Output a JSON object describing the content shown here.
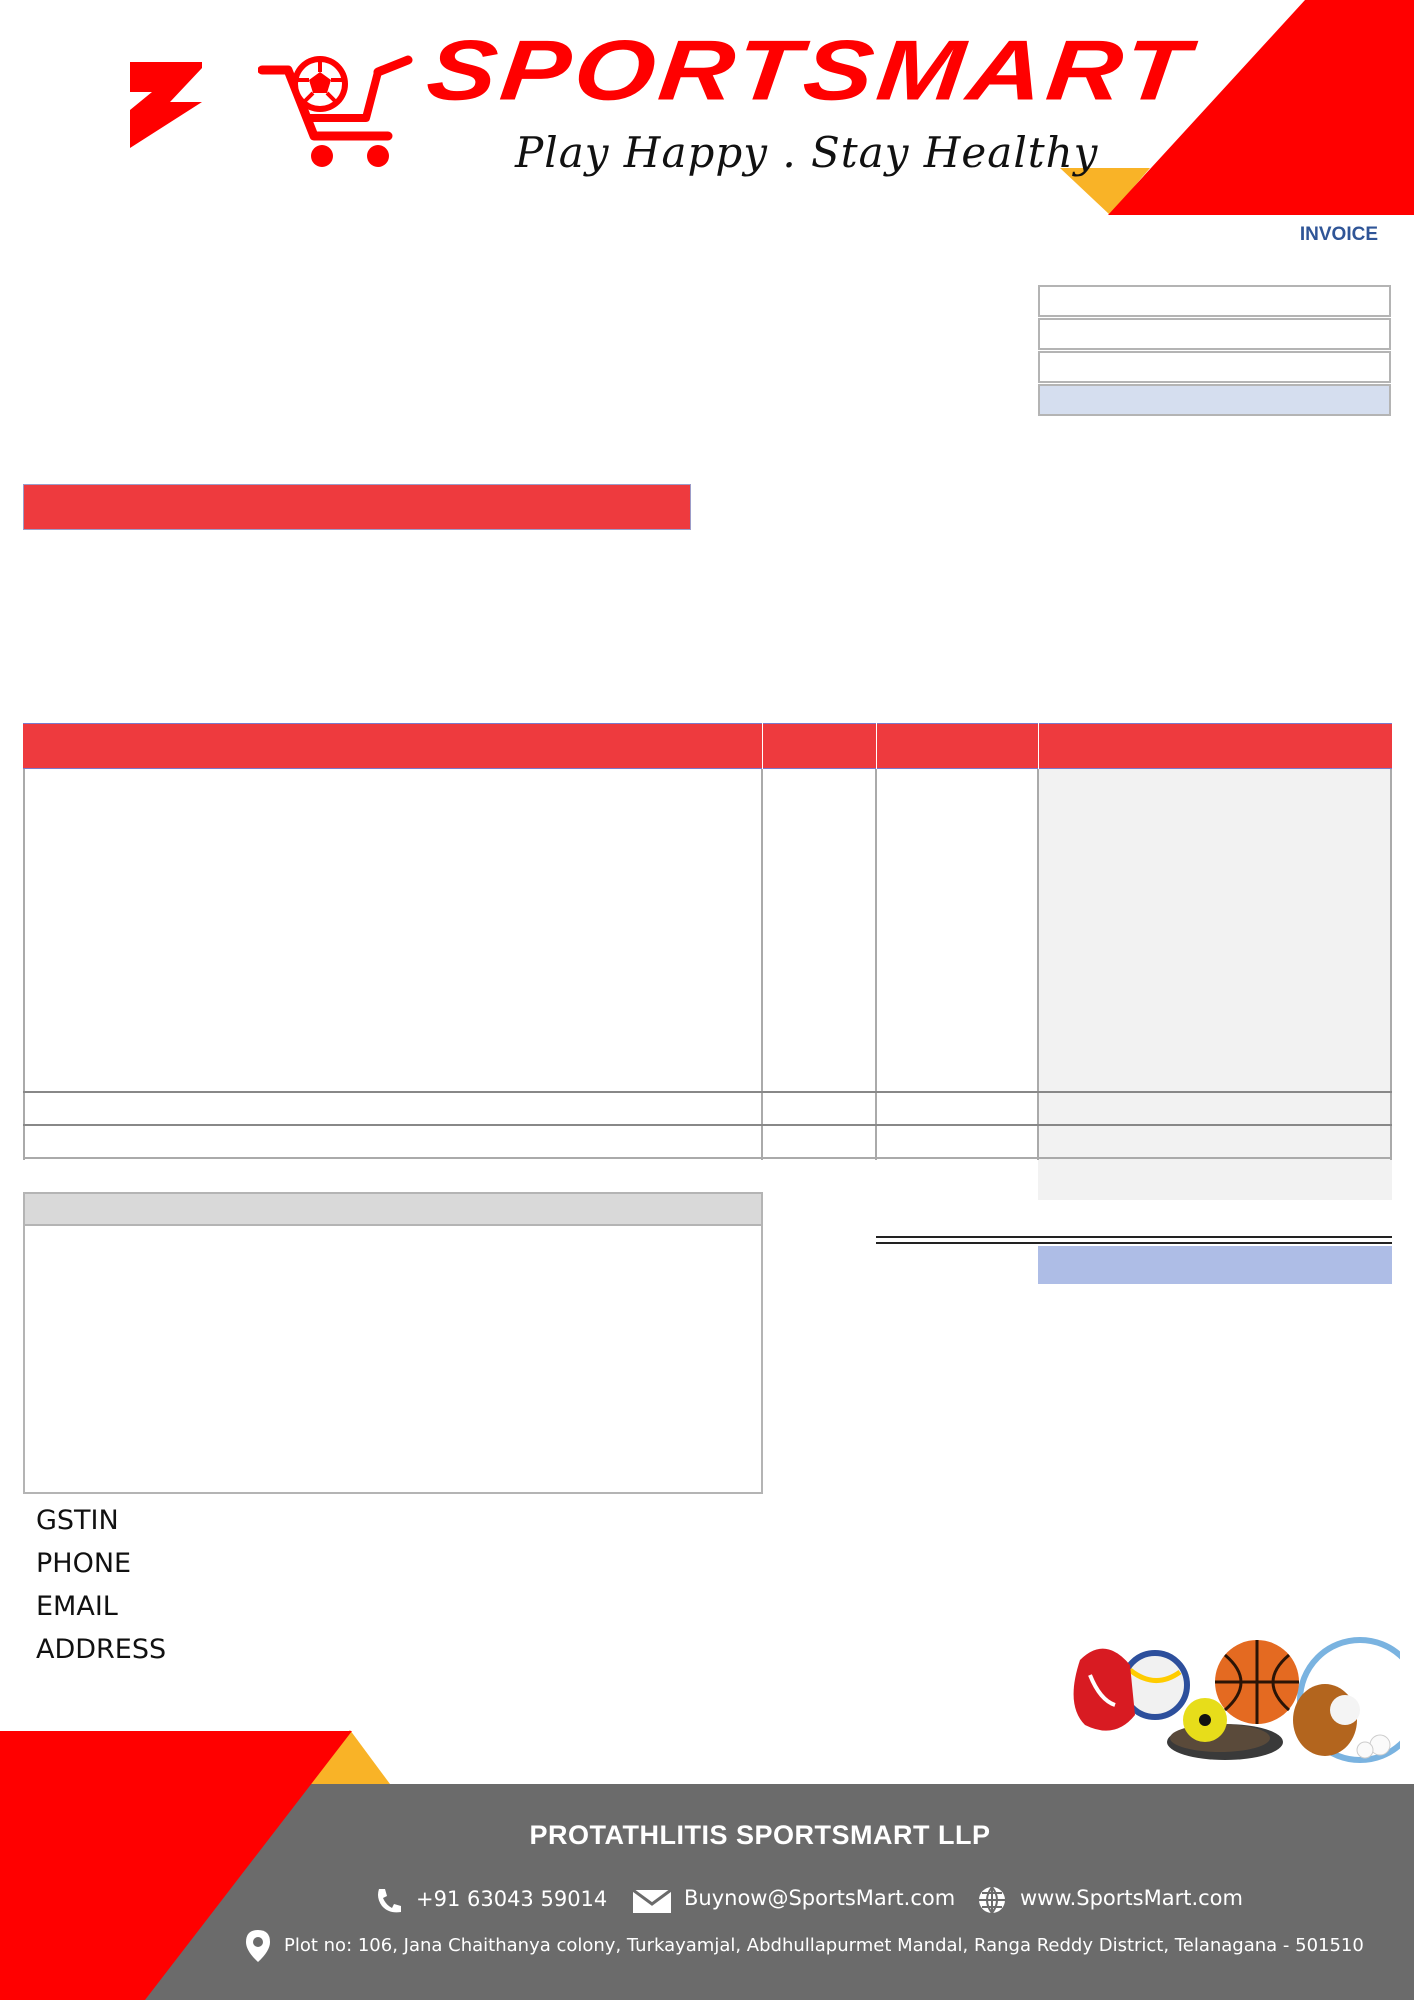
{
  "header": {
    "brand_name": "SPORTSMART",
    "tagline": "Play Happy . Stay Healthy",
    "document_label": "INVOICE"
  },
  "contact_labels": {
    "gstin": "GSTIN",
    "phone": "PHONE",
    "email": "EMAIL",
    "address": "ADDRESS"
  },
  "footer": {
    "company": "PROTATHLITIS SPORTSMART LLP",
    "phone": "+91 63043 59014",
    "email": "Buynow@SportsMart.com",
    "website": "www.SportsMart.com",
    "address": "Plot no: 106, Jana Chaithanya colony, Turkayamjal, Abdhullapurmet Mandal, Ranga Reddy District, Telanagana - 501510"
  },
  "colors": {
    "brand_red": "#ff0000",
    "bar_red": "#ee3a3e",
    "accent_yellow": "#f9b327",
    "footer_gray": "#6b6b6b",
    "invoice_blue": "#2f5597",
    "highlight_blue": "#d5deef",
    "total_blue": "#aebde6"
  },
  "icons": {
    "logo_mark": "bolt-icon",
    "cart": "cart-icon",
    "phone": "phone-icon",
    "email": "mail-icon",
    "website": "globe-icon",
    "address": "location-pin-icon"
  }
}
